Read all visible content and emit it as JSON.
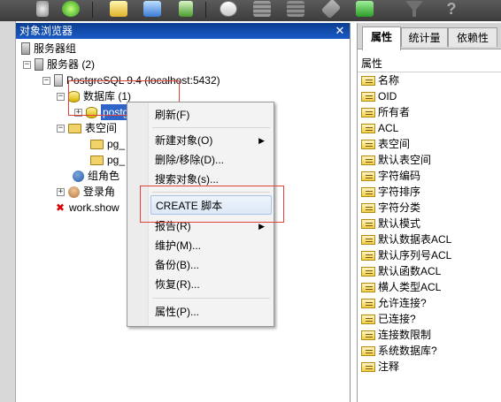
{
  "panel": {
    "title": "对象浏览器",
    "close": "✕"
  },
  "tree": {
    "server_group": "服务器组",
    "servers": "服务器 (2)",
    "server": "PostgreSQL 9.4 (localhost:5432)",
    "databases": "数据库 (1)",
    "database": "postgres",
    "tablespaces": "表空间",
    "pg1": "pg_",
    "pg2": "pg_",
    "group_roles": "组角色",
    "login_roles": "登录角",
    "other": "work.show"
  },
  "context_menu": {
    "items": [
      "刷新(F)",
      "新建对象(O)",
      "删除/移除(D)...",
      "搜索对象(s)...",
      "CREATE 脚本",
      "报告(R)",
      "维护(M)...",
      "备份(B)...",
      "恢复(R)...",
      "属性(P)..."
    ],
    "submenu_arrow": "▶"
  },
  "right_panel": {
    "tabs": [
      "属性",
      "统计量",
      "依赖性"
    ],
    "header": "属性",
    "properties": [
      "名称",
      "OID",
      "所有者",
      "ACL",
      "表空间",
      "默认表空间",
      "字符编码",
      "字符排序",
      "字符分类",
      "默认模式",
      "默认数据表ACL",
      "默认序列号ACL",
      "默认函数ACL",
      "横人类型ACL",
      "允许连接?",
      "已连接?",
      "连接数限制",
      "系统数据库?",
      "注释"
    ]
  },
  "colors": {
    "title_bar": "#1a5bc7",
    "selection": "#2f64c8",
    "highlight_box": "#e0413b"
  },
  "icons": {
    "toolbar": [
      "connect-icon",
      "refresh-icon",
      "properties-icon",
      "create-icon",
      "delete-icon",
      "sql-icon",
      "grid-icon",
      "table-icon",
      "wrench-icon",
      "plugin-icon",
      "filter-icon",
      "help-icon"
    ]
  }
}
